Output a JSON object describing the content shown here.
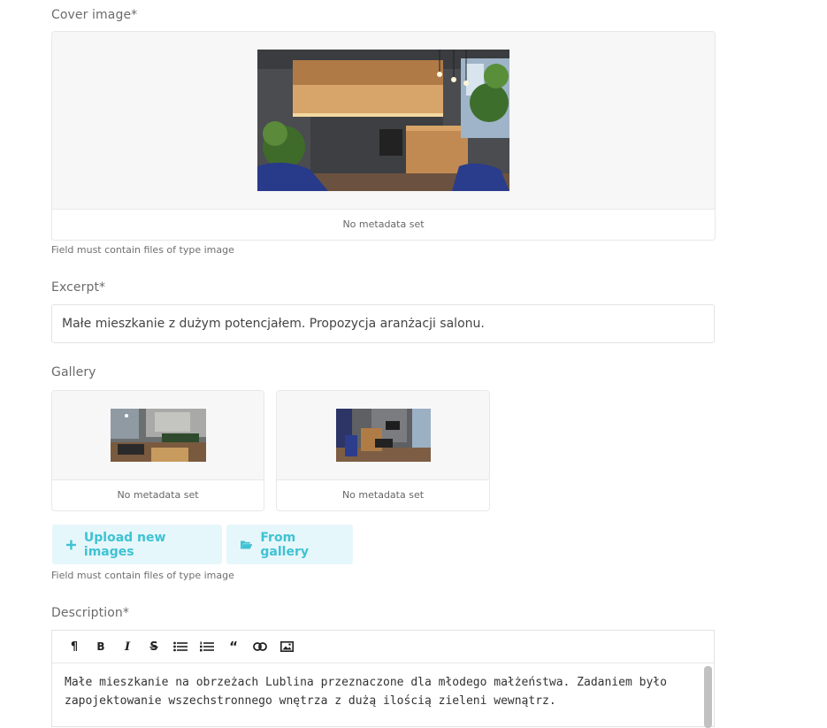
{
  "cover": {
    "label": "Cover image*",
    "metadata": "No metadata set",
    "hint": "Field must contain files of type image"
  },
  "excerpt": {
    "label": "Excerpt*",
    "value": "Małe mieszkanie z dużym potencjałem. Propozycja aranżacji salonu."
  },
  "gallery": {
    "label": "Gallery",
    "items": [
      {
        "metadata": "No metadata set"
      },
      {
        "metadata": "No metadata set"
      }
    ],
    "upload_label": "Upload new images",
    "from_gallery_label": "From gallery",
    "hint": "Field must contain files of type image"
  },
  "description": {
    "label": "Description*",
    "toolbar": [
      "paragraph-icon",
      "bold-icon",
      "italic-icon",
      "strikethrough-icon",
      "bullet-list-icon",
      "numbered-list-icon",
      "quote-icon",
      "link-icon",
      "image-icon"
    ],
    "text_line1": "Małe mieszkanie na obrzeżach Lublina przeznaczone dla młodego małżeństwa. Zadaniem było",
    "text_line2": "zapojektowanie wszechstronnego wnętrza z dużą ilością zieleni wewnątrz."
  },
  "colors": {
    "accent": "#3fc2d3",
    "button_bg": "#e6f7fb"
  }
}
